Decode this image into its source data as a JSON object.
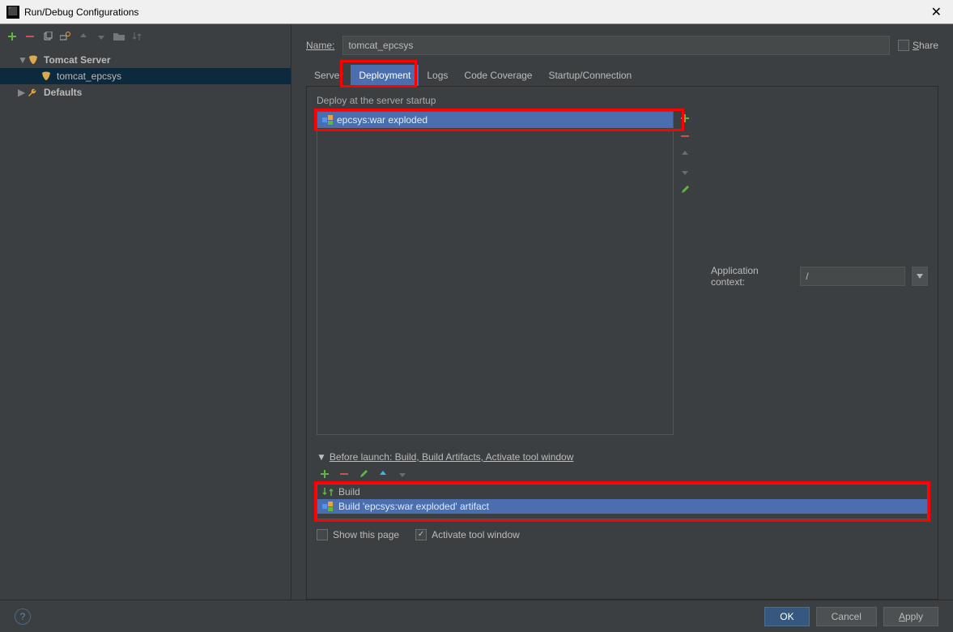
{
  "window": {
    "title": "Run/Debug Configurations"
  },
  "sidebar": {
    "tomcat_server": "Tomcat Server",
    "config_name": "tomcat_epcsys",
    "defaults": "Defaults"
  },
  "main": {
    "name_label": "Name:",
    "name_value": "tomcat_epcsys",
    "share_label": "Share",
    "tabs": {
      "server": "Server",
      "deployment": "Deployment",
      "logs": "Logs",
      "code_coverage": "Code Coverage",
      "startup": "Startup/Connection"
    },
    "deploy_label": "Deploy at the server startup",
    "deploy_item": "epcsys:war exploded",
    "context_label": "Application context:",
    "context_value": "/",
    "before_launch_header": "Before launch: Build, Build Artifacts, Activate tool window",
    "build_item": "Build",
    "build_artifact_item": "Build 'epcsys:war exploded' artifact",
    "show_page": "Show this page",
    "activate_window": "Activate tool window"
  },
  "footer": {
    "ok": "OK",
    "cancel": "Cancel",
    "apply": "Apply"
  }
}
